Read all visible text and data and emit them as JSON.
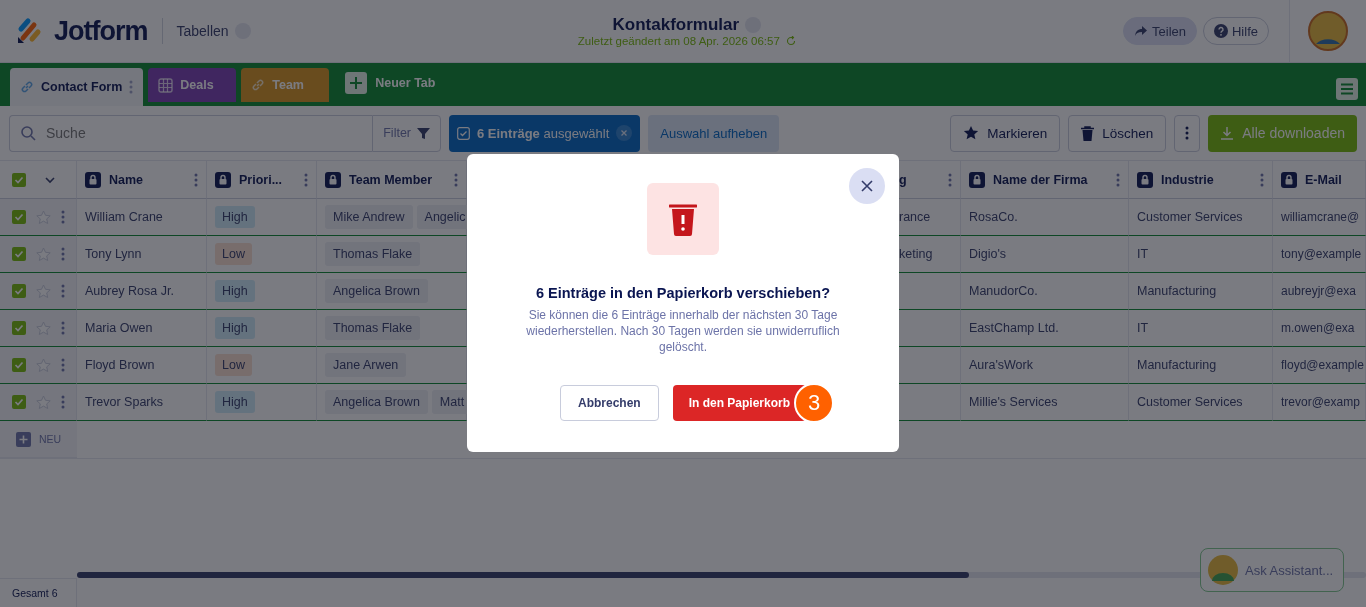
{
  "header": {
    "logo": "Jotform",
    "menu": "Tabellen",
    "title": "Kontakformular",
    "subtitle": "Zuletzt geändert am 08 Apr. 2026 06:57",
    "buttons": [
      {
        "kind": "share",
        "label": "Teilen"
      },
      {
        "kind": "help",
        "label": "Hilfe"
      }
    ]
  },
  "tabs": [
    {
      "label": "Contact Form",
      "kind": "form",
      "selected": true
    },
    {
      "label": "Deals",
      "kind": "table",
      "selected": false
    },
    {
      "label": "Team",
      "kind": "form",
      "selected": false
    }
  ],
  "new_tab": "Neuer Tab",
  "toolbar": {
    "search": {
      "placeholder": "Suche"
    },
    "filter": "Filter",
    "selection": "**6 Einträge** ausgewählt",
    "clear": "Auswahl aufheben",
    "actions": [
      {
        "kind": "star",
        "label": "Markieren"
      },
      {
        "kind": "trash",
        "label": "Löschen"
      },
      {
        "kind": "more"
      }
    ],
    "download": "Alle downloaden"
  },
  "table": {
    "header_checked": true,
    "columns": [
      {
        "label": "Name"
      },
      {
        "label": "Priori..."
      },
      {
        "label": "Team Member"
      },
      {
        "kind": "hidden"
      },
      {
        "label": "g",
        "kind": "cut"
      },
      {
        "label": "Name der Firma"
      },
      {
        "label": "Industrie"
      },
      {
        "label": "E-Mail",
        "kind": "edge"
      }
    ],
    "rows": [
      {
        "checked": true,
        "starred": false,
        "name": "William Crane",
        "priority": {
          "text": "High",
          "kind": "high"
        },
        "team": [
          "Mike Andrew",
          "Angelic"
        ],
        "column_5": "rance",
        "company": "RosaCo.",
        "industry": "Customer Services",
        "email": "williamcrane@"
      },
      {
        "checked": true,
        "starred": false,
        "name": "Tony Lynn",
        "priority": {
          "text": "Low",
          "kind": "low"
        },
        "team": [
          "Thomas Flake"
        ],
        "column_5": "keting",
        "company": "Digio's",
        "industry": "IT",
        "email": "tony@example"
      },
      {
        "checked": true,
        "starred": false,
        "name": "Aubrey Rosa Jr.",
        "priority": {
          "text": "High",
          "kind": "high"
        },
        "team": [
          "Angelica Brown"
        ],
        "company": "ManudorCo.",
        "industry": "Manufacturing",
        "email": "aubreyjr@exa"
      },
      {
        "checked": true,
        "starred": false,
        "name": "Maria Owen",
        "priority": {
          "text": "High",
          "kind": "high"
        },
        "team": [
          "Thomas Flake"
        ],
        "company": "EastChamp Ltd.",
        "industry": "IT",
        "email": "m.owen@exa"
      },
      {
        "checked": true,
        "starred": false,
        "name": "Floyd Brown",
        "priority": {
          "text": "Low",
          "kind": "low"
        },
        "team": [
          "Jane Arwen"
        ],
        "company": "Aura'sWork",
        "industry": "Manufacturing",
        "email": "floyd@example"
      },
      {
        "checked": true,
        "starred": false,
        "name": "Trevor Sparks",
        "priority": {
          "text": "High",
          "kind": "high"
        },
        "team": [
          "Angelica Brown",
          "Matt"
        ],
        "company": "Millie's Services",
        "industry": "Customer Services",
        "email": "trevor@examp"
      }
    ],
    "new_row": "NEU"
  },
  "footer": {
    "total": "Gesamt 6",
    "assistant": "Ask Assistant..."
  },
  "modal": {
    "title": "6 Einträge in den Papierkorb verschieben?",
    "message": "Sie können die 6 Einträge innerhalb der nächsten 30 Tage wiederherstellen. Nach 30 Tagen werden sie unwiderruflich gelöscht.",
    "cancel": "Abbrechen",
    "confirm": "In den Papierkorb",
    "step": "3"
  }
}
